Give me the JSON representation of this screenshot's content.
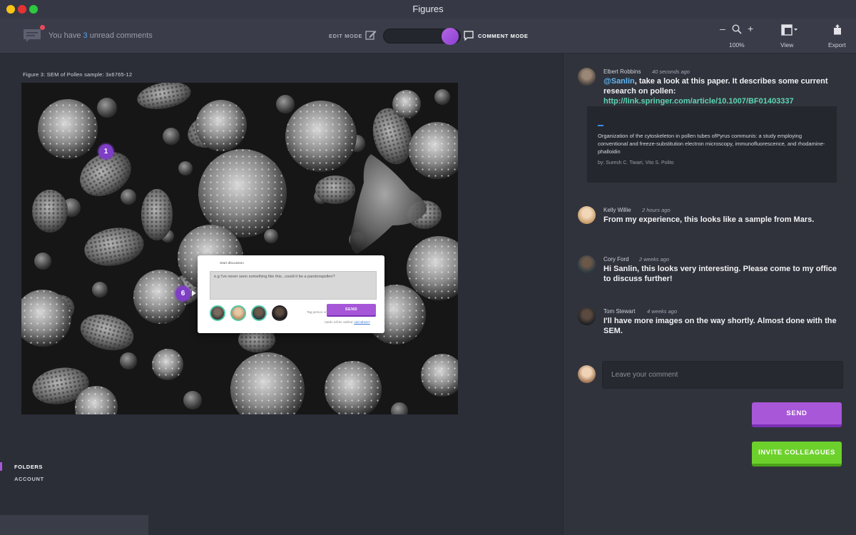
{
  "window": {
    "title": "Figures"
  },
  "toolbar": {
    "unread_prefix": "You have ",
    "unread_count": "3",
    "unread_suffix": " unread comments",
    "edit_mode_label": "EDIT MODE",
    "comment_mode_label": "COMMENT MODE",
    "zoom_minus": "–",
    "zoom_plus": "+",
    "zoom_level": "100%",
    "view_label": "View",
    "export_label": "Export",
    "mode_active": "comment"
  },
  "figure": {
    "caption": "Figure 3: SEM of Pollen sample: 3x6765-12",
    "markers": [
      "1",
      "6"
    ]
  },
  "discussion_popup": {
    "title": "Start discussion",
    "text": "e.g I've never seen something like this...could it be a pandorapollen?",
    "or_label": "Tag person or",
    "send_label": "SEND",
    "notify_prefix": "Sanlin will be notified. ",
    "notify_link": "Add others?"
  },
  "nav": {
    "items": [
      {
        "label": "FOLDERS",
        "active": true
      },
      {
        "label": "ACCOUNT",
        "active": false
      }
    ]
  },
  "comments": [
    {
      "author": "Elbert Robbins",
      "time": "40 seconds ago",
      "mention": "@Sanlin",
      "text": ", take a look at this paper. It describes some current research on pollen: ",
      "link": "http://link.springer.com/article/10.1007/BF01403337",
      "card": {
        "title": "Organization of the cytoskeleton in pollen tubes ofPyrus communis: a study employing conventional and freeze-substitution electron microscopy, immunofluorescence, and rhodamine-phalloidin",
        "authors": "by: Suresh C. Tiwari, Vito S. Polito"
      }
    },
    {
      "author": "Kelly Willie",
      "time": "2 hours ago",
      "text": "From my experience, this looks like a sample from Mars."
    },
    {
      "author": "Cory Ford",
      "time": "2 weeks ago",
      "text": "Hi Sanlin, this looks very interesting. Please come to my office to discuss further!"
    },
    {
      "author": "Tom Stewart",
      "time": "4 weeks ago",
      "text": "I'll have more images on the way shortly. Almost done with the SEM."
    }
  ],
  "composer": {
    "placeholder": "Leave your comment",
    "send_label": "SEND",
    "invite_label": "INVITE COLLEAGUES"
  },
  "colors": {
    "accent_purple": "#a857d8",
    "accent_green": "#6dd12c",
    "unread_blue": "#5a9ff0",
    "mention_blue": "#5fb7f5",
    "link_teal": "#5fd5b4",
    "notification_red": "#e94a5b"
  }
}
